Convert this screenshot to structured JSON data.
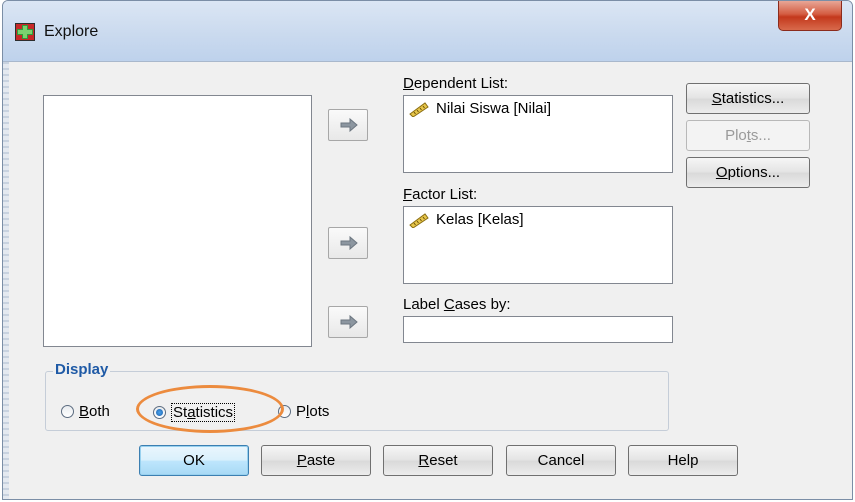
{
  "window": {
    "title": "Explore",
    "close_label": "X"
  },
  "lists": {
    "dependent": {
      "label_pre": "",
      "label_key": "D",
      "label_post": "ependent List:",
      "items": [
        "Nilai Siswa [Nilai]"
      ]
    },
    "factor": {
      "label_pre": "",
      "label_key": "F",
      "label_post": "actor List:",
      "items": [
        "Kelas [Kelas]"
      ]
    },
    "label_cases": {
      "label_pre": "Label ",
      "label_key": "C",
      "label_post": "ases by:",
      "value": ""
    }
  },
  "side_buttons": {
    "statistics": {
      "pre": "",
      "key": "S",
      "post": "tatistics..."
    },
    "plots": {
      "pre": "Plo",
      "key": "t",
      "post": "s..."
    },
    "options": {
      "pre": "",
      "key": "O",
      "post": "ptions..."
    }
  },
  "display": {
    "title": "Display",
    "both": {
      "pre": "",
      "key": "B",
      "post": "oth"
    },
    "statistics": {
      "pre": "St",
      "key": "a",
      "post": "tistics"
    },
    "plots": {
      "pre": "P",
      "key": "l",
      "post": "ots"
    },
    "selected": "statistics"
  },
  "bottom_buttons": {
    "ok": "OK",
    "paste": {
      "pre": "",
      "key": "P",
      "post": "aste"
    },
    "reset": {
      "pre": "",
      "key": "R",
      "post": "eset"
    },
    "cancel": "Cancel",
    "help": "Help"
  },
  "icons": {
    "title_icon": "explore-app-icon",
    "arrow": "move-right-arrow-icon",
    "scale_variable": "ruler-scale-variable-icon"
  },
  "colors": {
    "highlight_ellipse": "#ec8b3e",
    "group_title": "#1f5aa6",
    "close_button": "#c3381c"
  }
}
